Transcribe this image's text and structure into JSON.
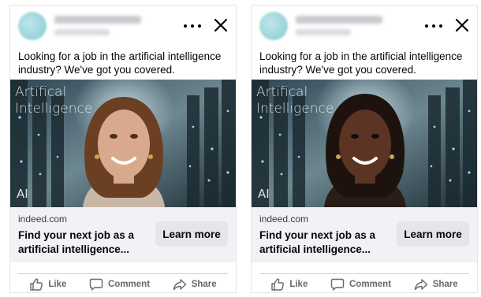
{
  "ads": [
    {
      "body_text": "Looking for a job in the artificial intelligence industry? We've got you covered.",
      "image": {
        "overlay_title": "Artifical Intelligence",
        "overlay_corner": "AI",
        "person_skin": "#d9a98e",
        "person_hair": "#6b3f22",
        "person_shirt": "#c9b8a6"
      },
      "domain": "indeed.com",
      "headline": "Find your next job as a artificial intelligence...",
      "cta_label": "Learn more",
      "actions": {
        "like": "Like",
        "comment": "Comment",
        "share": "Share"
      }
    },
    {
      "body_text": "Looking for a job in the artificial intelligence industry? We've got you covered.",
      "image": {
        "overlay_title": "Artifical Intelligence",
        "overlay_corner": "AI",
        "person_skin": "#5b3424",
        "person_hair": "#1d120d",
        "person_shirt": "#2a1c16"
      },
      "domain": "indeed.com",
      "headline": "Find your next job as a artificial intelligence...",
      "cta_label": "Learn more",
      "actions": {
        "like": "Like",
        "comment": "Comment",
        "share": "Share"
      }
    }
  ],
  "colors": {
    "cta_bg": "#e4e6eb",
    "action_text": "#65676b",
    "avatar": "#9fd6dc"
  },
  "icons": [
    "more-icon",
    "close-icon",
    "like-icon",
    "comment-icon",
    "share-icon"
  ]
}
